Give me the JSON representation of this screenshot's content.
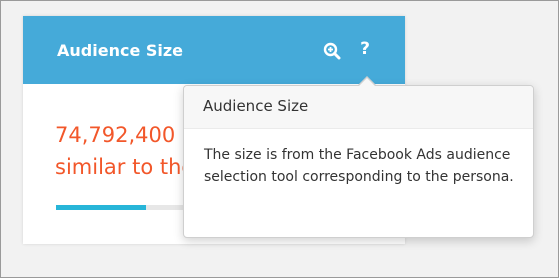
{
  "card": {
    "title": "Audience Size",
    "stat_value": "74,792,400",
    "stat_subtext": "similar to the persona",
    "progress_fraction": 0.3,
    "icons": [
      "zoom-in-icon",
      "help-icon"
    ]
  },
  "tooltip": {
    "title": "Audience Size",
    "body": "The size is from the Facebook Ads audience selection tool corresponding to the persona."
  },
  "colors": {
    "header_bg": "#45aad9",
    "stat_text": "#f2572a",
    "progress_fill": "#27b5d8",
    "progress_track": "#e7e7e7",
    "tooltip_header_bg": "#f7f7f7"
  }
}
